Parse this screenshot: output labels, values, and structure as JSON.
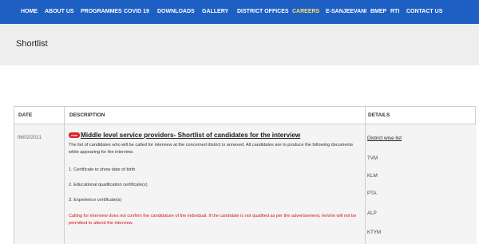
{
  "nav": {
    "items": [
      {
        "label": "HOME",
        "active": false
      },
      {
        "label": "ABOUT US",
        "active": false
      },
      {
        "label": "PROGRAMMES",
        "active": false
      },
      {
        "label": "COVID 19",
        "active": false
      },
      {
        "label": "DOWNLOADS",
        "active": false
      },
      {
        "label": "GALLERY",
        "active": false
      },
      {
        "label": "DISTRICT OFFICES",
        "active": false
      },
      {
        "label": "CAREERS",
        "active": true
      },
      {
        "label": "E-SANJEEVANI",
        "active": false
      },
      {
        "label": "BMEP",
        "active": false
      },
      {
        "label": "RTI",
        "active": false
      },
      {
        "label": "CONTACT US",
        "active": false
      }
    ]
  },
  "page": {
    "title": "Shortlist"
  },
  "table": {
    "headers": {
      "date": "DATE",
      "description": "DESCRIPTION",
      "details": "DETAILS"
    },
    "row": {
      "date": "06/02/2021",
      "badge": "new",
      "title": "Middle level service providers- Shortlist of candidates for the interview",
      "intro": "The list of candidates who will be called for interview at the concerned district is annexed. All candidates are to produce the following documents while appearing for the interview.",
      "items": [
        "1. Certificate to show date of birth",
        "2. Educational qualification certificate(s)",
        "3. Experience certificate(s)"
      ],
      "warning": "Calling for interview does not confirm the candidature of the individual. If the candidate is not qualified as per the advertisement, he/she will not be permitted to attend the interview.",
      "details_title": "District wise list",
      "districts": [
        "TVM",
        "KLM",
        "PTA",
        "ALP",
        "KTYM"
      ]
    }
  },
  "colors": {
    "nav_bg": "#1e5fc4",
    "nav_active": "#ffe066",
    "warning": "#d41414",
    "badge": "#d9262b"
  }
}
